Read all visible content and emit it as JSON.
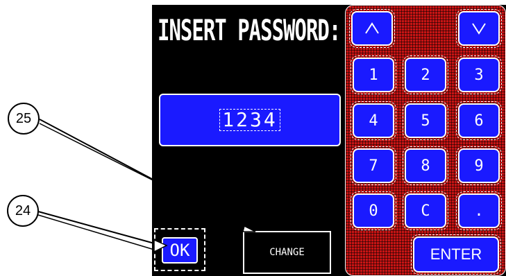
{
  "screen": {
    "title": "INSERT PASSWORD:",
    "password_value": "1234"
  },
  "keypad": {
    "up_icon": "chevron-up-icon",
    "down_icon": "chevron-down-icon",
    "rows": [
      [
        "1",
        "2",
        "3"
      ],
      [
        "4",
        "5",
        "6"
      ],
      [
        "7",
        "8",
        "9"
      ],
      [
        "0",
        "C",
        "."
      ]
    ],
    "enter_label": "ENTER"
  },
  "actions": {
    "ok_label": "OK",
    "change_label": "CHANGE"
  },
  "callouts": {
    "c25": "25",
    "c24": "24"
  },
  "colors": {
    "screen_bg": "#000000",
    "key_blue": "#1a1aff",
    "keypad_red": "#c81414",
    "text": "#ffffff"
  }
}
